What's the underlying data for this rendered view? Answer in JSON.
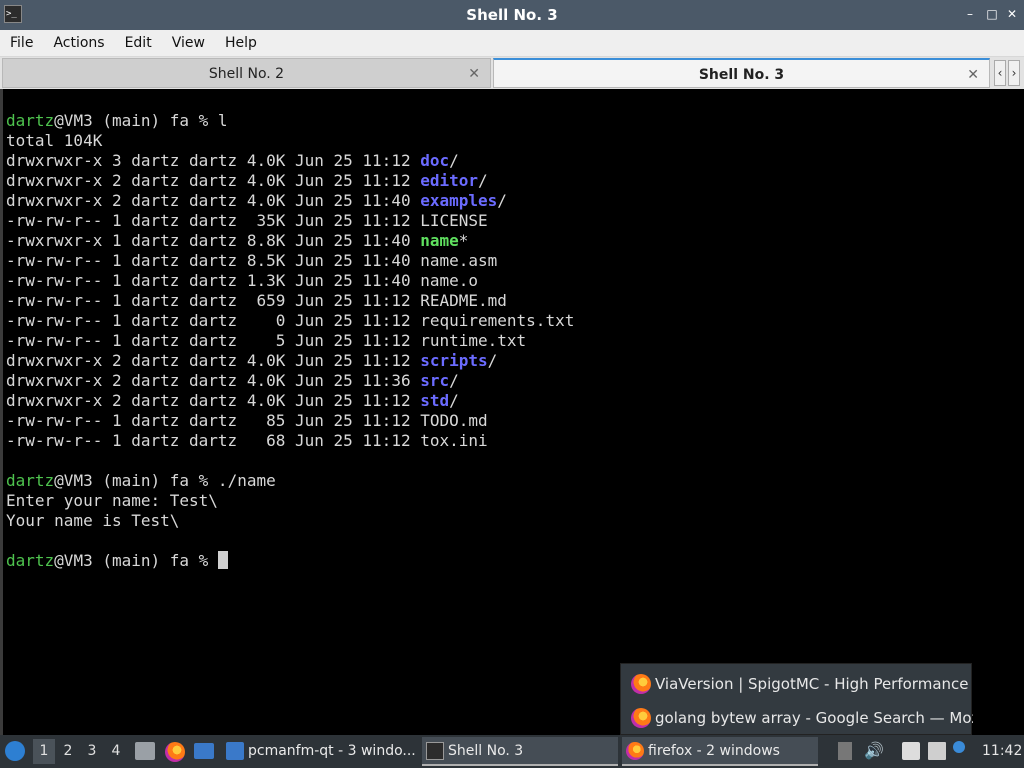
{
  "window": {
    "title": "Shell No. 3"
  },
  "menu": [
    "File",
    "Actions",
    "Edit",
    "View",
    "Help"
  ],
  "tabs": [
    {
      "label": "Shell No. 2",
      "active": false
    },
    {
      "label": "Shell No. 3",
      "active": true
    }
  ],
  "terminal": {
    "lines": [
      [
        {
          "t": "dartz",
          "c": "user"
        },
        {
          "t": "@VM3 (main) fa % l"
        }
      ],
      [
        {
          "t": "total 104K"
        }
      ],
      [
        {
          "t": "drwxrwxr-x 3 dartz dartz 4.0K Jun 25 11:12 "
        },
        {
          "t": "doc",
          "c": "dir"
        },
        {
          "t": "/"
        }
      ],
      [
        {
          "t": "drwxrwxr-x 2 dartz dartz 4.0K Jun 25 11:12 "
        },
        {
          "t": "editor",
          "c": "dir"
        },
        {
          "t": "/"
        }
      ],
      [
        {
          "t": "drwxrwxr-x 2 dartz dartz 4.0K Jun 25 11:40 "
        },
        {
          "t": "examples",
          "c": "dir"
        },
        {
          "t": "/"
        }
      ],
      [
        {
          "t": "-rw-rw-r-- 1 dartz dartz  35K Jun 25 11:12 LICENSE"
        }
      ],
      [
        {
          "t": "-rwxrwxr-x 1 dartz dartz 8.8K Jun 25 11:40 "
        },
        {
          "t": "name",
          "c": "exe"
        },
        {
          "t": "*"
        }
      ],
      [
        {
          "t": "-rw-rw-r-- 1 dartz dartz 8.5K Jun 25 11:40 name.asm"
        }
      ],
      [
        {
          "t": "-rw-rw-r-- 1 dartz dartz 1.3K Jun 25 11:40 name.o"
        }
      ],
      [
        {
          "t": "-rw-rw-r-- 1 dartz dartz  659 Jun 25 11:12 README.md"
        }
      ],
      [
        {
          "t": "-rw-rw-r-- 1 dartz dartz    0 Jun 25 11:12 requirements.txt"
        }
      ],
      [
        {
          "t": "-rw-rw-r-- 1 dartz dartz    5 Jun 25 11:12 runtime.txt"
        }
      ],
      [
        {
          "t": "drwxrwxr-x 2 dartz dartz 4.0K Jun 25 11:12 "
        },
        {
          "t": "scripts",
          "c": "dir"
        },
        {
          "t": "/"
        }
      ],
      [
        {
          "t": "drwxrwxr-x 2 dartz dartz 4.0K Jun 25 11:36 "
        },
        {
          "t": "src",
          "c": "dir"
        },
        {
          "t": "/"
        }
      ],
      [
        {
          "t": "drwxrwxr-x 2 dartz dartz 4.0K Jun 25 11:12 "
        },
        {
          "t": "std",
          "c": "dir"
        },
        {
          "t": "/"
        }
      ],
      [
        {
          "t": "-rw-rw-r-- 1 dartz dartz   85 Jun 25 11:12 TODO.md"
        }
      ],
      [
        {
          "t": "-rw-rw-r-- 1 dartz dartz   68 Jun 25 11:12 tox.ini"
        }
      ],
      [],
      [
        {
          "t": "dartz",
          "c": "user"
        },
        {
          "t": "@VM3 (main) fa % ./name"
        }
      ],
      [
        {
          "t": "Enter your name: Test\\"
        }
      ],
      [
        {
          "t": "Your name is Test\\"
        }
      ],
      [],
      [
        {
          "t": "dartz",
          "c": "user"
        },
        {
          "t": "@VM3 (main) fa % "
        },
        {
          "t": "",
          "c": "cursor"
        }
      ]
    ]
  },
  "popup": {
    "items": [
      {
        "label": "ViaVersion | SpigotMC - High Performance ..."
      },
      {
        "label": "golang bytew array - Google Search — Mozi..."
      }
    ]
  },
  "taskbar": {
    "desktops": [
      "1",
      "2",
      "3",
      "4"
    ],
    "active_desktop": "1",
    "tasks": [
      {
        "label": "pcmanfm-qt - 3 windo..."
      },
      {
        "label": "Shell No. 3"
      },
      {
        "label": "firefox - 2 windows"
      }
    ],
    "clock": "11:42"
  },
  "colors": {
    "user": "#4ec34e",
    "dir": "#6b6bff",
    "exe": "#5fe05f",
    "accent": "#3b8ed8"
  }
}
